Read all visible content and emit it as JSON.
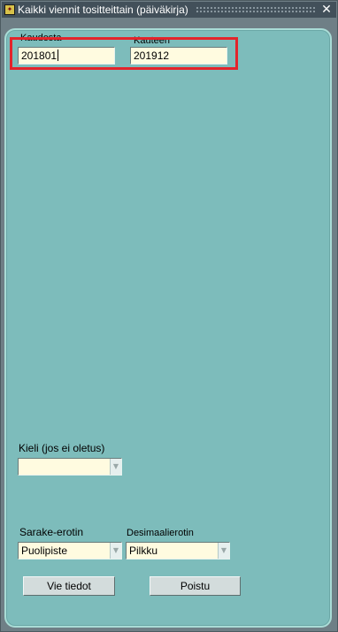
{
  "window": {
    "title": "Kaikki viennit tositteittain (päiväkirja)",
    "close_icon": "close-icon",
    "app_icon": "oracle-forms-icon"
  },
  "period": {
    "from_label": "Kaudesta",
    "from_value": "201801",
    "to_label": "Kauteen",
    "to_value": "201912"
  },
  "language": {
    "label": "Kieli (jos ei oletus)",
    "value": ""
  },
  "separators": {
    "column_label": "Sarake-erotin",
    "column_value": "Puolipiste",
    "decimal_label": "Desimaalierotin",
    "decimal_value": "Pilkku"
  },
  "buttons": {
    "export": "Vie tiedot",
    "exit": "Poistu"
  },
  "colors": {
    "panel": "#7dbcbb",
    "field": "#fffbe0",
    "highlight": "#e3242b"
  }
}
